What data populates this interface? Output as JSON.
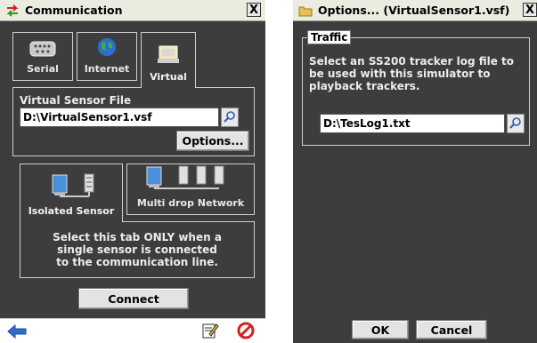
{
  "left_window": {
    "title": "Communication",
    "close_label": "X",
    "tabs": [
      {
        "label": "Serial",
        "icon": "serial-port-icon"
      },
      {
        "label": "Internet",
        "icon": "globe-icon"
      },
      {
        "label": "Virtual",
        "icon": "virtual-folder-icon"
      }
    ],
    "active_tab": "Virtual",
    "virtual_sensor_file_label": "Virtual Sensor File",
    "virtual_sensor_file_value": "D:\\VirtualSensor1.vsf",
    "options_button": "Options...",
    "sensor_tabs": [
      {
        "label": "Isolated Sensor",
        "icon": "isolated-sensor-icon"
      },
      {
        "label": "Multi drop Network",
        "icon": "multi-drop-network-icon"
      }
    ],
    "active_sensor_tab": "Isolated Sensor",
    "sensor_description": [
      "Select this tab ONLY when a",
      "single sensor is connected",
      "to the communication line."
    ],
    "connect_button": "Connect",
    "bottom_icons": [
      "back-arrow-icon",
      "edit-note-icon",
      "stop-icon"
    ]
  },
  "right_window": {
    "title": "Options... (VirtualSensor1.vsf)",
    "close_label": "X",
    "group_label": "Traffic",
    "description": [
      "Select an SS200 tracker log file to",
      "be used with this simulator to",
      "playback trackers."
    ],
    "log_file_value": "D:\\TesLog1.txt",
    "ok_button": "OK",
    "cancel_button": "Cancel"
  },
  "colors": {
    "window_bg": "#3d3d3d",
    "titlebar_bg": "#ecebe0",
    "text_light": "#ececec",
    "stop_red": "#d42020",
    "back_blue": "#2f6fc8"
  }
}
